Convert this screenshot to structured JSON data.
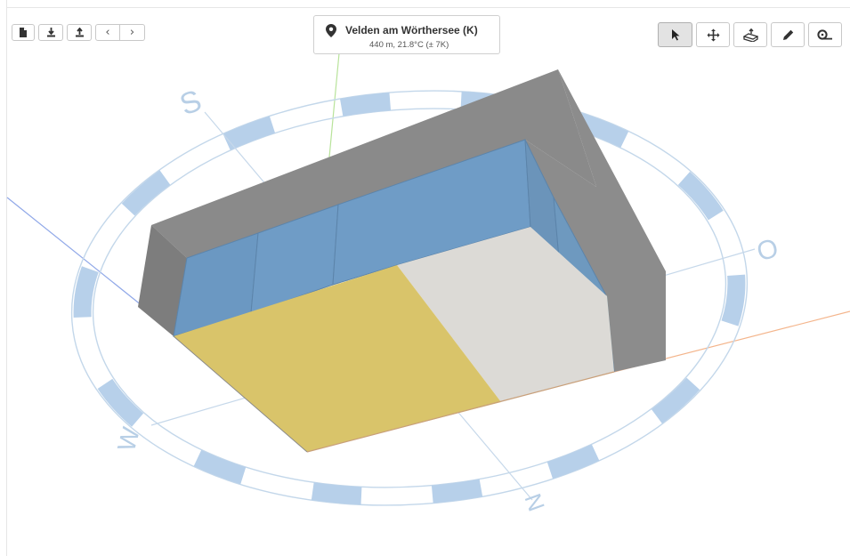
{
  "location": {
    "name": "Velden am Wörthersee (K)",
    "details": "440 m, 21.8°C (± 7K)",
    "icon": "map-pin-icon"
  },
  "toolbar_left": {
    "buttons": [
      "new-file-icon",
      "download-icon",
      "upload-icon"
    ],
    "prev_label": "‹",
    "next_label": "›"
  },
  "toolbar_right": {
    "tools": [
      "select-pointer-icon",
      "move-icon",
      "extrude-icon",
      "pencil-icon",
      "measure-tape-icon"
    ],
    "active_tool": "select-pointer-icon"
  },
  "compass": {
    "north": "N",
    "south": "S",
    "east": "O",
    "west": "W"
  },
  "colors": {
    "accent_blue": "#6f9cc6",
    "floor_yellow": "#d9c46a",
    "floor_grey": "#dcdad6",
    "wall_grey": "#8c8c8c",
    "compass_blue": "#b9d3ea"
  }
}
